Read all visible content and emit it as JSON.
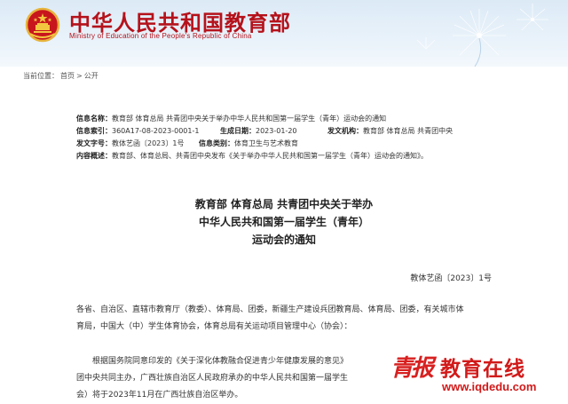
{
  "header": {
    "title": "中华人民共和国教育部",
    "subtitle": "Ministry of Education of the People's Republic of China",
    "emblem_icon": "national-emblem-icon",
    "accent_color": "#b5121b"
  },
  "breadcrumb": {
    "label": "当前位置：",
    "home": "首页",
    "separator": ">",
    "current": "公开"
  },
  "info": {
    "name_label": "信息名称：",
    "name_value": "教育部 体育总局 共青团中央关于举办中华人民共和国第一届学生（青年）运动会的通知",
    "index_label": "信息索引：",
    "index_value": "360A17-08-2023-0001-1",
    "date_label": "生成日期：",
    "date_value": "2023-01-20",
    "org_label": "发文机构：",
    "org_value": "教育部 体育总局 共青团中央",
    "docno_label": "发文字号：",
    "docno_value": "教体艺函〔2023〕1号",
    "category_label": "信息类别：",
    "category_value": "体育卫生与艺术教育",
    "summary_label": "内容概述：",
    "summary_value": "教育部、体育总局、共青团中央发布《关于举办中华人民共和国第一届学生（青年）运动会的通知》。"
  },
  "document": {
    "title_line1": "教育部 体育总局 共青团中央关于举办",
    "title_line2": "中华人民共和国第一届学生（青年）",
    "title_line3": "运动会的通知",
    "doc_number": "教体艺函〔2023〕1号",
    "para1_line1": "各省、自治区、直辖市教育厅（教委）、体育局、团委，新疆生产建设兵团教育局、体育局、团委，有关城市体",
    "para1_line2": "育局，中国大（中）学生体育协会，体育总局有关运动项目管理中心（协会）：",
    "para2_line1": "根据国务院同意印发的《关于深化体教融合促进青少年健康发展的意见》",
    "para2_line2": "团中央共同主办，广西壮族自治区人民政府承办的中华人民共和国第一届学生",
    "para2_line3": "会）将于2023年11月在广西壮族自治区举办。"
  },
  "watermark": {
    "brush_text": "青报",
    "main_text": "教育在线",
    "url": "www.iqdedu.com"
  }
}
